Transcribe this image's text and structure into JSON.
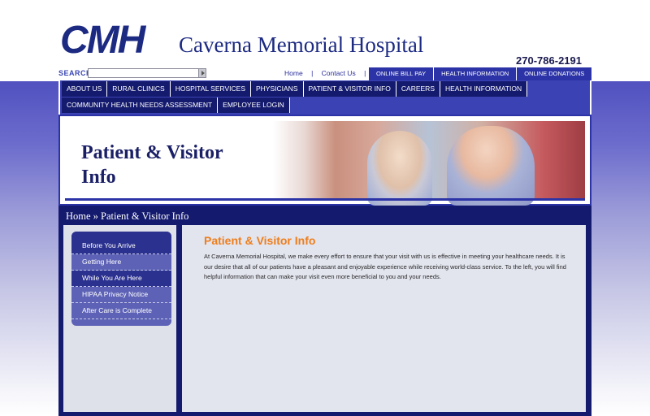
{
  "header": {
    "logo_mark": "CMH",
    "hospital_name": "Caverna Memorial Hospital",
    "phone": "270-786-2191"
  },
  "search": {
    "label": "SEARCH",
    "value": "",
    "button_icon": "arrow-right-icon"
  },
  "utility_links": {
    "home": "Home",
    "separator": "|",
    "contact": "Contact Us"
  },
  "top_tabs": [
    "ONLINE BILL PAY",
    "HEALTH INFORMATION",
    "ONLINE DONATIONS"
  ],
  "nav": {
    "row1": [
      "ABOUT US",
      "RURAL CLINICS",
      "HOSPITAL SERVICES",
      "PHYSICIANS",
      "PATIENT & VISITOR INFO",
      "CAREERS",
      "HEALTH INFORMATION"
    ],
    "row2": [
      "COMMUNITY HEALTH NEEDS ASSESSMENT",
      "EMPLOYEE LOGIN"
    ]
  },
  "banner": {
    "title_line1": "Patient & Visitor",
    "title_line2": "Info"
  },
  "breadcrumb": "Home » Patient & Visitor Info",
  "sidebar": {
    "items": [
      "Before You Arrive",
      "Getting Here",
      "While You Are Here",
      "HIPAA Privacy Notice",
      "After Care is Complete"
    ]
  },
  "content": {
    "title": "Patient & Visitor Info",
    "body": "At Caverna Memorial Hospital, we make every effort to ensure that your visit with us is effective in meeting your healthcare needs.  It is our desire that all of our patients have a pleasant and enjoyable experience while receiving world-class service.  To the left, you will find helpful information that can make your visit even more beneficial to you and your needs."
  },
  "colors": {
    "brand_navy": "#141a6e",
    "brand_blue": "#2b33a6",
    "accent_orange": "#ef7d1a"
  }
}
